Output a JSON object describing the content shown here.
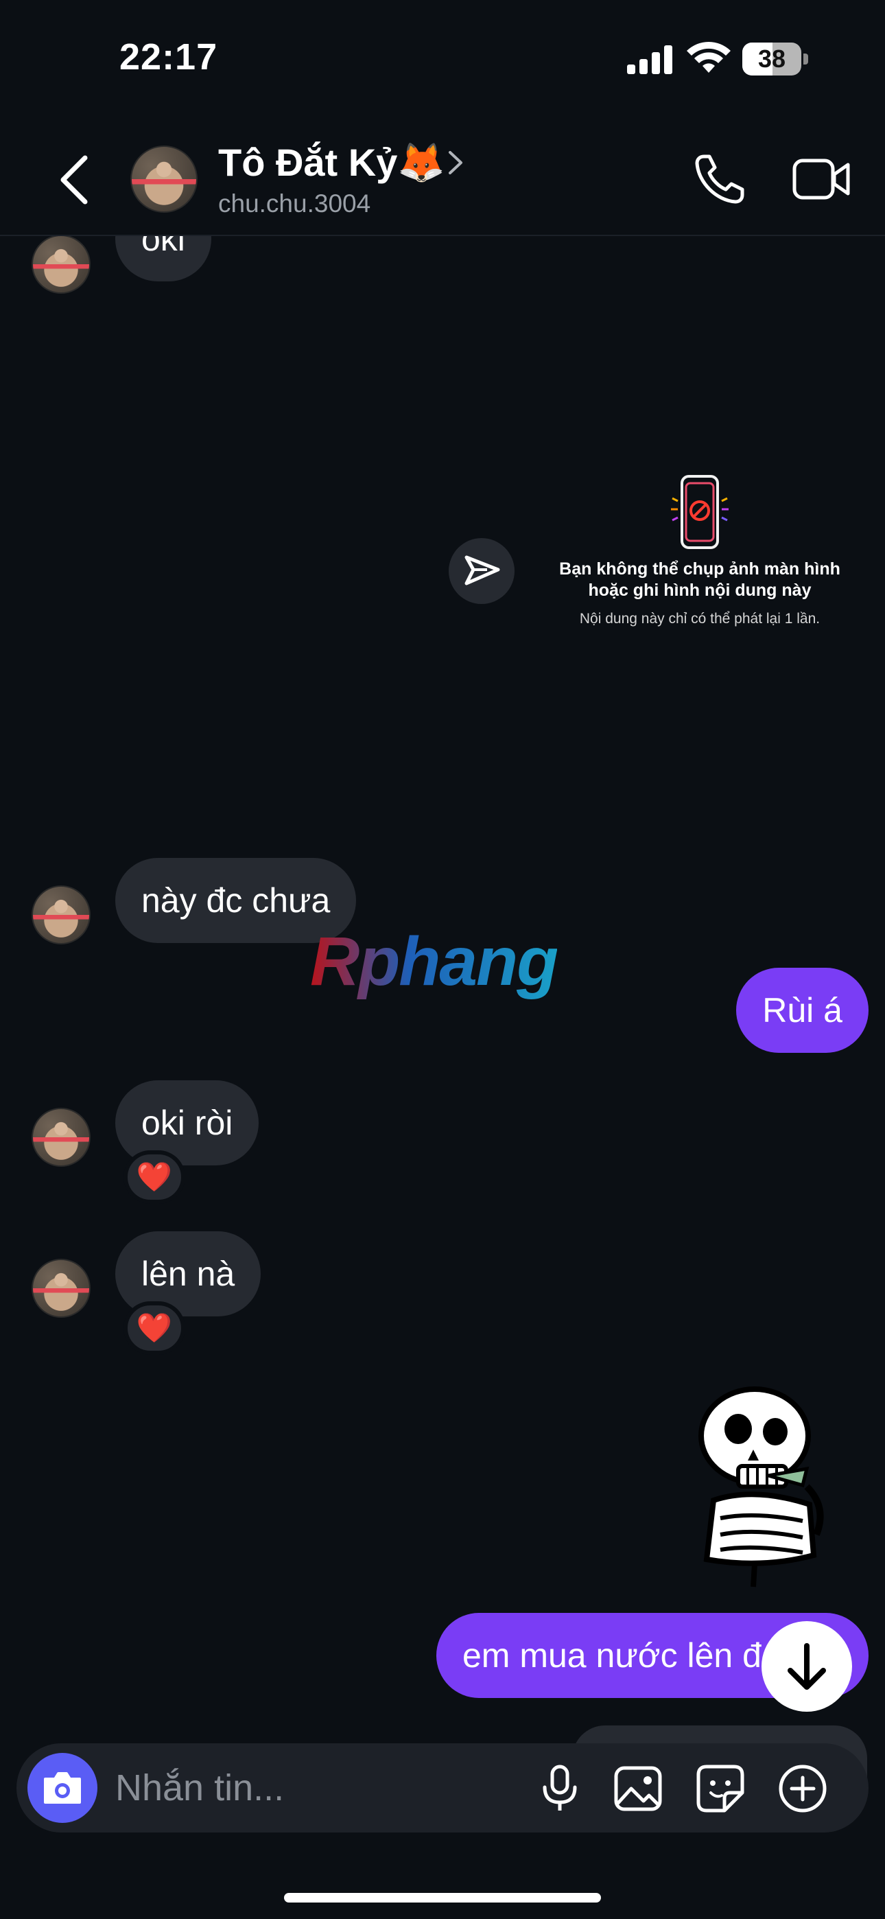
{
  "status_bar": {
    "time": "22:17",
    "battery": "38"
  },
  "header": {
    "name": "Tô Đắt Kỷ🦊",
    "username": "chu.chu.3004"
  },
  "messages": {
    "partial_top": "oki",
    "vanish_title": "Bạn không thể chụp ảnh màn hình hoặc ghi hình nội dung này",
    "vanish_subtitle": "Nội dung này chỉ có thể phát lại 1 lần.",
    "m1": "này đc chưa",
    "m2": "Rùi á",
    "m3": "oki ròi",
    "m3_reaction": "❤️",
    "m4": "lên nà",
    "m4_reaction": "❤️",
    "m5": "em mua nước lên đ"
  },
  "watermark": "Rphang",
  "composer": {
    "placeholder": "Nhắn tin..."
  },
  "colors": {
    "outgoing_bubble": "#7a3df5",
    "incoming_bubble": "#262a31",
    "background": "#0b0f14",
    "camera_button": "#5a5df5"
  }
}
